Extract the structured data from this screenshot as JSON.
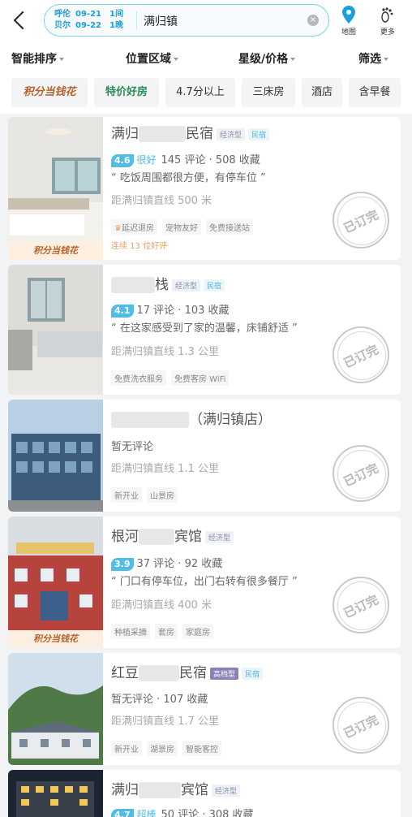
{
  "header": {
    "city_from": "呼伦",
    "date_in": "09-21",
    "nights_top": "1间",
    "city_to": "贝尔",
    "date_out": "09-22",
    "nights_bottom": "1晚",
    "destination": "满归镇",
    "map_label": "地图",
    "more_label": "更多",
    "accent": "#1aa0d8"
  },
  "sort": {
    "smart": "智能排序",
    "area": "位置区域",
    "star_price": "星级/价格",
    "filter": "筛选"
  },
  "chips": [
    "积分当钱花",
    "特价好房",
    "4.7分以上",
    "三床房",
    "酒店",
    "含早餐"
  ],
  "hotels": [
    {
      "name_a": "满归",
      "name_b": "民宿",
      "type": "经济型",
      "cat": "民宿",
      "score": "4.6",
      "score_label": "很好",
      "stats": "145 评论 · 508 收藏",
      "quote": "“ 吃饭周围都很方便，有停车位 ”",
      "distance": "距满归镇直线 500 米",
      "features": [
        "延迟退房",
        "宠物友好",
        "免费接送站"
      ],
      "streak": "连续 13 位好评",
      "badge": "积分当钱花",
      "status": "已订完"
    },
    {
      "name_a": "",
      "name_b": "栈",
      "type": "经济型",
      "cat": "民宿",
      "score": "4.1",
      "stats": "17 评论 · 103 收藏",
      "quote": "“ 在这家感受到了家的温馨，床铺舒适 ”",
      "distance": "距满归镇直线 1.3 公里",
      "features": [
        "免费洗衣服务",
        "免费客房 WiFi"
      ],
      "status": "已订完"
    },
    {
      "name_a": "",
      "name_b": "（满归镇店）",
      "stats": "暂无评论",
      "distance": "距满归镇直线 1.1 公里",
      "features": [
        "新开业",
        "山景房"
      ],
      "status": "已订完"
    },
    {
      "name_a": "根河",
      "name_b": "宾馆",
      "type": "经济型",
      "score": "3.9",
      "stats": "37 评论 · 92 收藏",
      "quote": "“ 门口有停车位，出门右转有很多餐厅 ”",
      "distance": "距满归镇直线 400 米",
      "features": [
        "种植采摘",
        "套房",
        "家庭房"
      ],
      "badge": "积分当钱花",
      "status": "已订完"
    },
    {
      "name_a": "红豆",
      "name_b": "民宿",
      "type": "高档型",
      "cat": "民宿",
      "stats": "暂无评论 · 107 收藏",
      "distance": "距满归镇直线 1.7 公里",
      "features": [
        "新开业",
        "湖景房",
        "智能客控"
      ],
      "status": "已订完"
    },
    {
      "name_a": "满归",
      "name_b": "宾馆",
      "type": "经济型",
      "score": "4.7",
      "score_label": "超棒",
      "stats": "50 评论 · 308 收藏"
    }
  ]
}
